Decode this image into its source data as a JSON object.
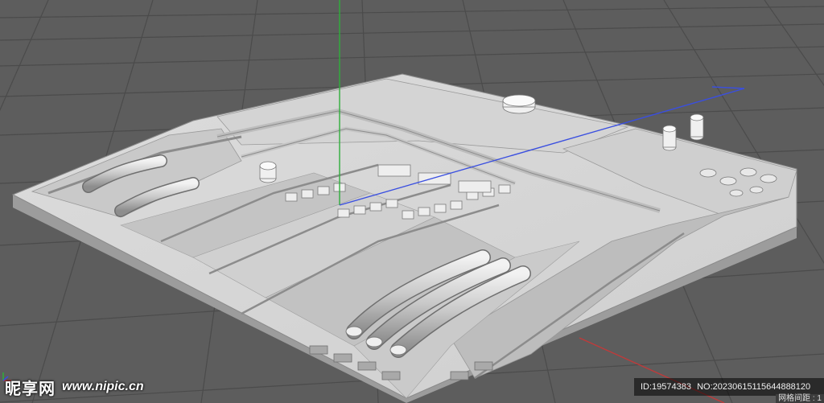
{
  "viewport": {
    "background_color": "#5d5d5d",
    "grid_line_color": "#4a4a4a",
    "model_color": "#d9d9d9",
    "axis_y_color": "#2fae3b",
    "axis_x_color": "#3a4fe0",
    "axis_z_color": "#c03a3a",
    "grid_spacing_label": "网格间距 : 1"
  },
  "watermark": {
    "site_name_cn": "昵享网",
    "site_url": "www.nipic.cn",
    "id_label": "ID:19574383",
    "no_label": "NO:20230615115644888120"
  },
  "icons": {
    "axis_marker": "axis-gizmo-icon"
  }
}
